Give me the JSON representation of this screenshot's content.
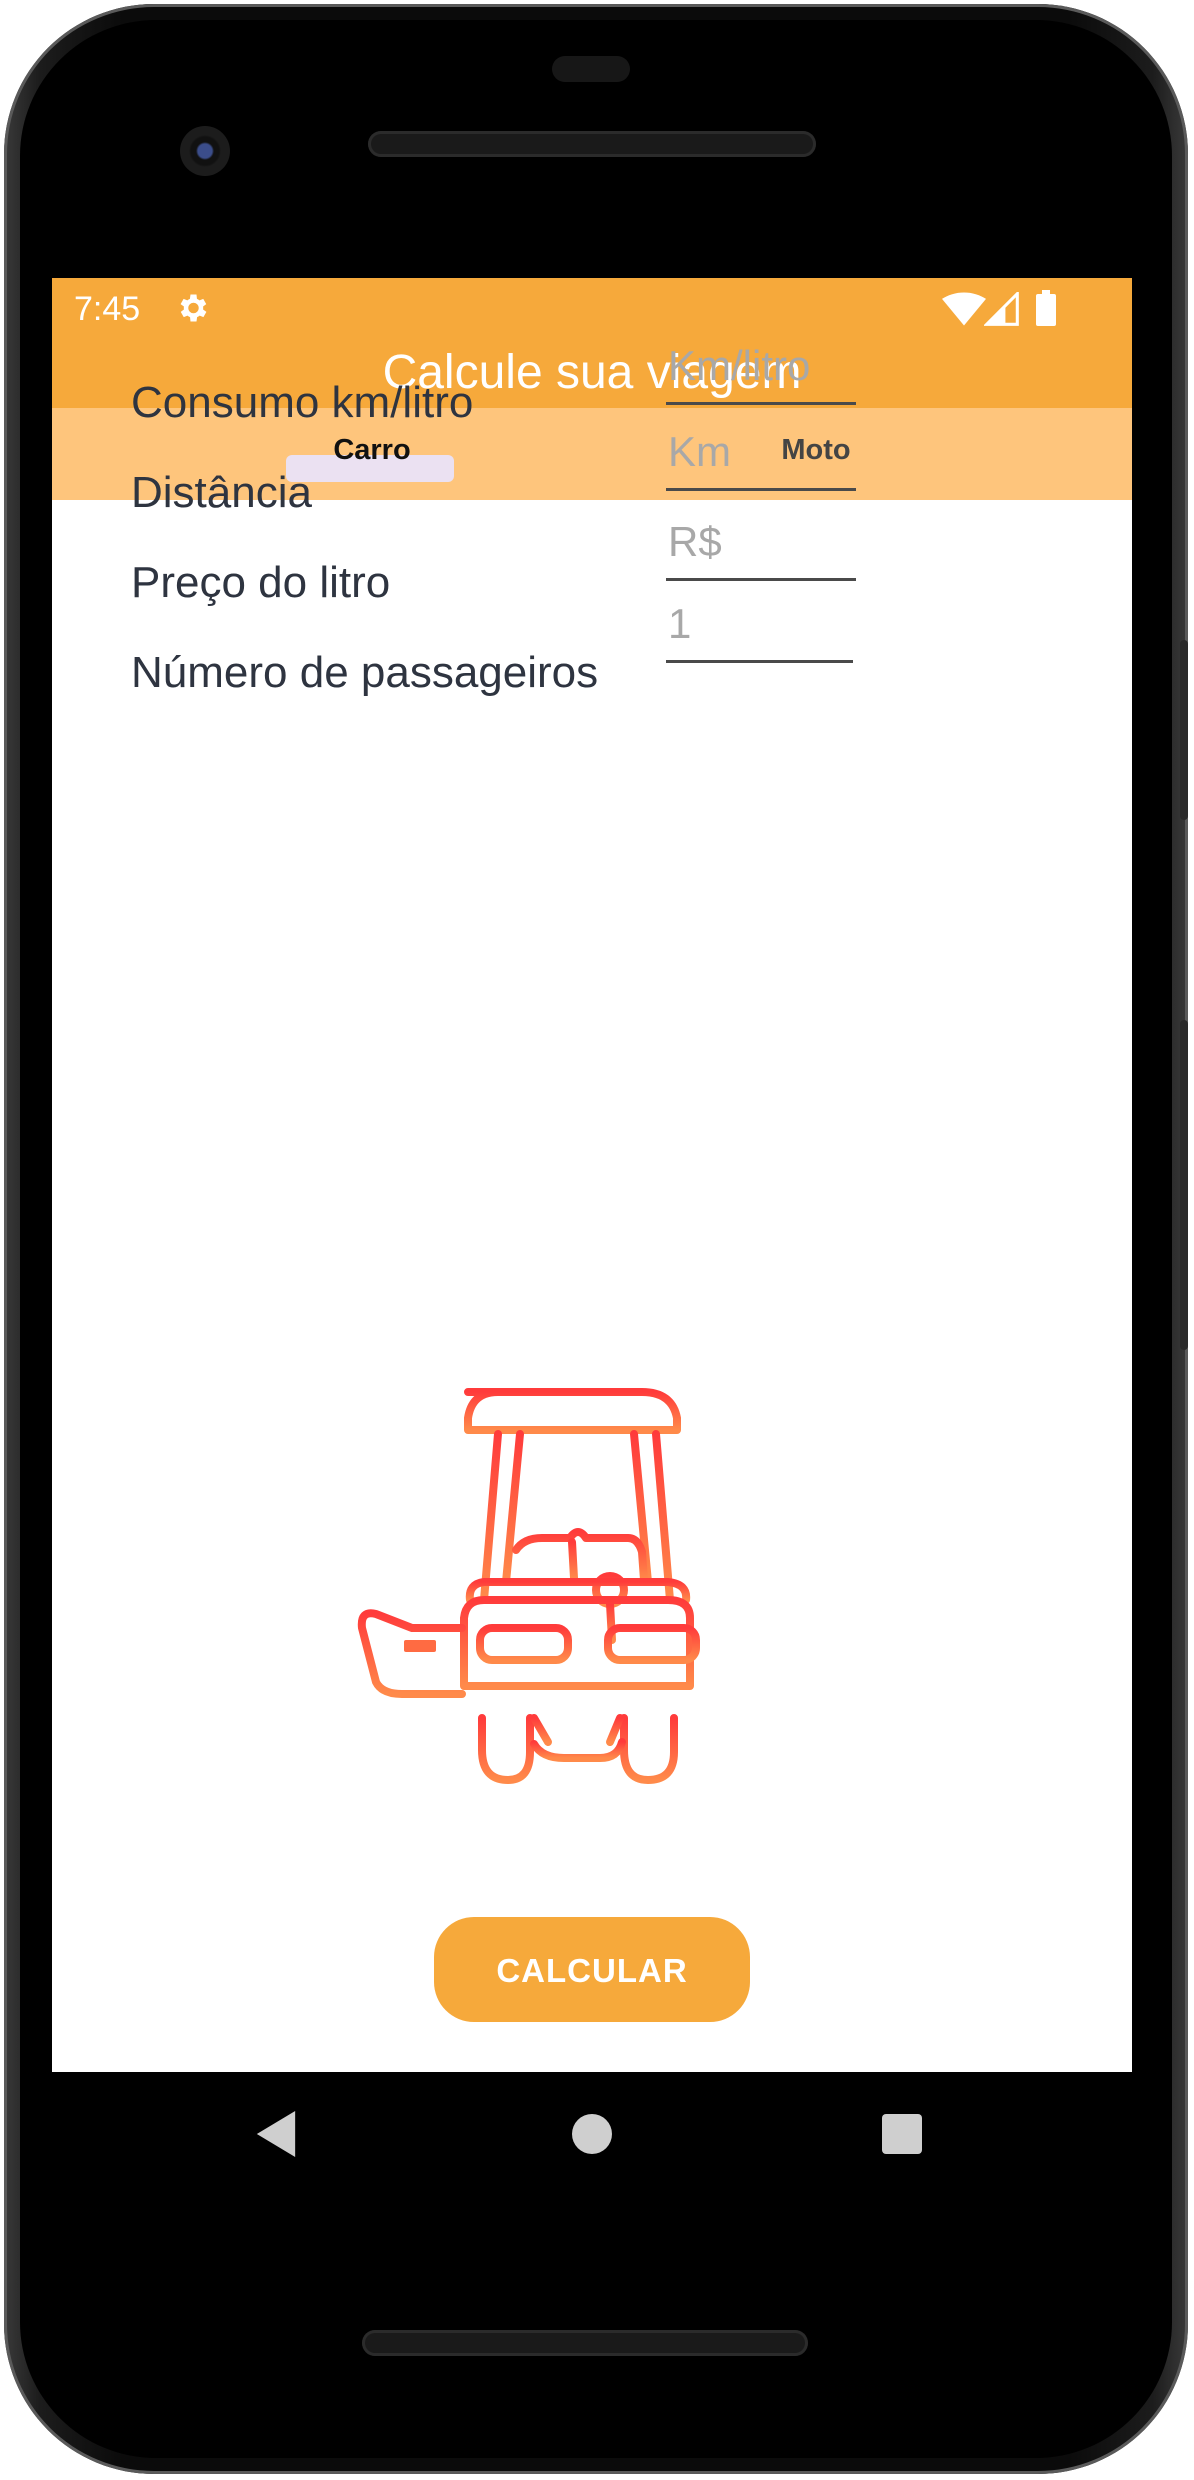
{
  "status_bar": {
    "time": "7:45",
    "icons": [
      "settings-icon",
      "wifi-icon",
      "signal-icon",
      "battery-icon"
    ]
  },
  "app": {
    "title": "Calcule sua viagem",
    "colors": {
      "primary": "#f6a93b",
      "tab_bar": "#fec57c",
      "illustration": "#ff4b3a"
    }
  },
  "tabs": [
    {
      "label": "Carro",
      "selected": true
    },
    {
      "label": "Moto",
      "selected": false
    }
  ],
  "form": {
    "consumo": {
      "label": "Consumo km/litro",
      "placeholder": "Km/litro"
    },
    "distancia": {
      "label": "Distância",
      "placeholder": "Km"
    },
    "preco": {
      "label": "Preço do litro",
      "placeholder": "R$"
    },
    "passageiros": {
      "label": "Número  de passageiros",
      "placeholder": "1"
    }
  },
  "illustration": {
    "icon": "golf-cart-icon"
  },
  "actions": {
    "calculate_label": "CALCULAR"
  },
  "nav": {
    "icons": [
      "back-icon",
      "home-icon",
      "recents-icon"
    ]
  }
}
